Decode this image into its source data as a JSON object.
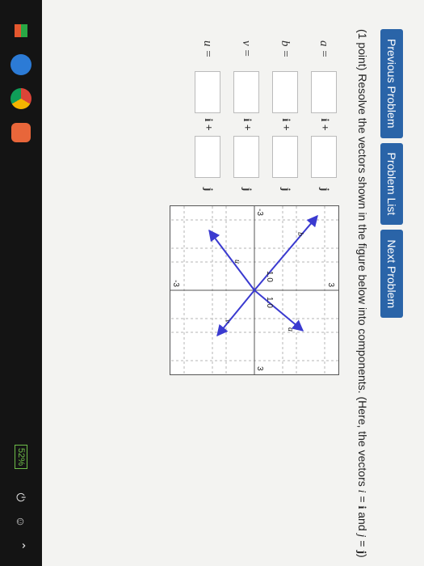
{
  "nav": {
    "previous": "Previous Problem",
    "list": "Problem List",
    "next": "Next Problem"
  },
  "prompt": {
    "points": "(1 point)",
    "text": "Resolve the vectors shown in the figure below into components. (Here, the vectors",
    "i_eq": "i",
    "and": "and",
    "j_eq": "j",
    "end": ")"
  },
  "answers": [
    {
      "label": "a =",
      "i_unit": "i +",
      "j_unit": "j"
    },
    {
      "label": "b =",
      "i_unit": "i +",
      "j_unit": "j"
    },
    {
      "label": "v =",
      "i_unit": "i +",
      "j_unit": "j"
    },
    {
      "label": "u =",
      "i_unit": "i +",
      "j_unit": "j"
    }
  ],
  "figure": {
    "tick_top": "3",
    "tick_bottom": "-3",
    "tick_left": "-3",
    "tick_right": "3",
    "label_a": "a",
    "label_b": "b",
    "label_u": "u",
    "label_v": "v",
    "len_a": "1.0",
    "len_b": "1.0",
    "vector_color": "#3a3ad0"
  },
  "taskbar": {
    "battery": "52%",
    "icons": [
      "edge-icon",
      "chrome-icon",
      "app-icon"
    ]
  }
}
